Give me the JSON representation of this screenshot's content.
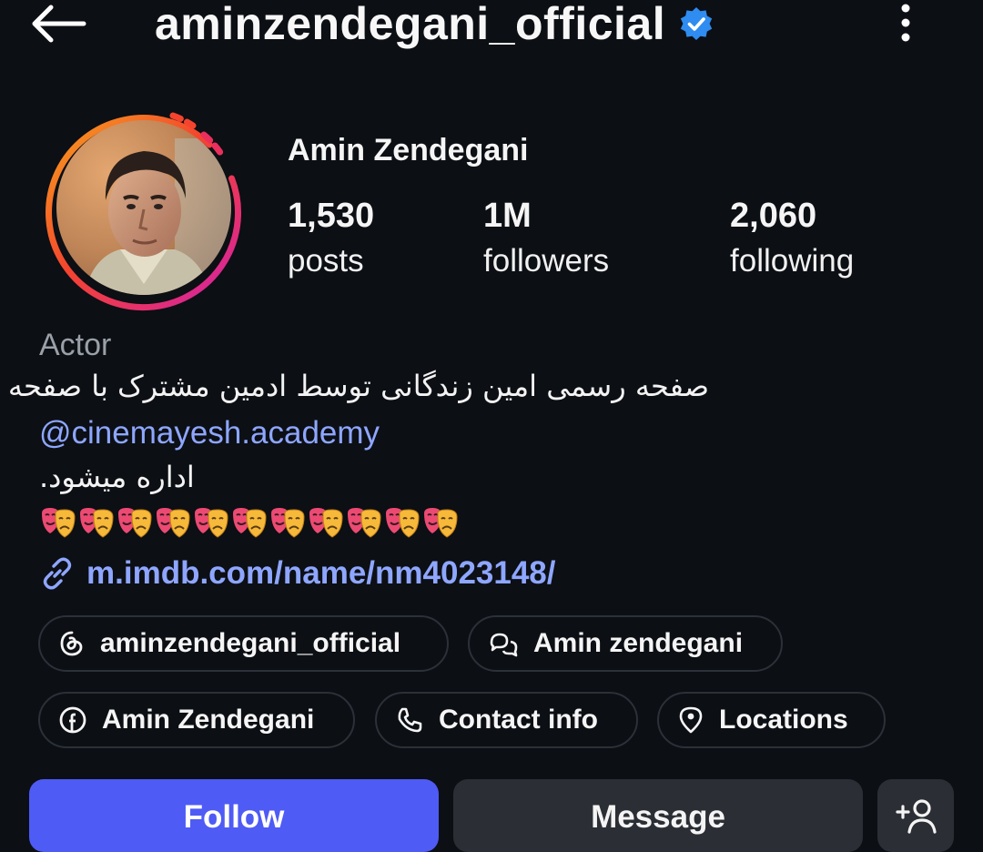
{
  "header": {
    "username": "aminzendegani_official",
    "back_icon": "arrow-left-icon",
    "verified_icon": "verified-badge-icon",
    "more_icon": "more-vertical-icon"
  },
  "profile": {
    "display_name": "Amin Zendegani",
    "stats": {
      "posts": {
        "value": "1,530",
        "label": "posts"
      },
      "followers": {
        "value": "1M",
        "label": "followers"
      },
      "following": {
        "value": "2,060",
        "label": "following"
      }
    },
    "category": "Actor",
    "bio_line1": "صفحه رسمی امین زندگانی توسط ادمین مشترک با صفحه",
    "mention": "@cinemayesh.academy",
    "bio_line2": "اداره میشود.",
    "emoji_count": 11,
    "emoji_name": "performing-arts-emoji",
    "link": "m.imdb.com/name/nm4023148/"
  },
  "chips": {
    "threads": "aminzendegani_official",
    "messenger": "Amin zendegani",
    "facebook": "Amin Zendegani",
    "contact": "Contact info",
    "locations": "Locations"
  },
  "actions": {
    "follow": "Follow",
    "message": "Message",
    "add_user_icon": "add-person-icon"
  },
  "colors": {
    "background": "#0c0f14",
    "accent": "#4e5bf5",
    "link": "#8ea6ff",
    "verified": "#2f8cf0",
    "muted": "#9aa0a8"
  }
}
